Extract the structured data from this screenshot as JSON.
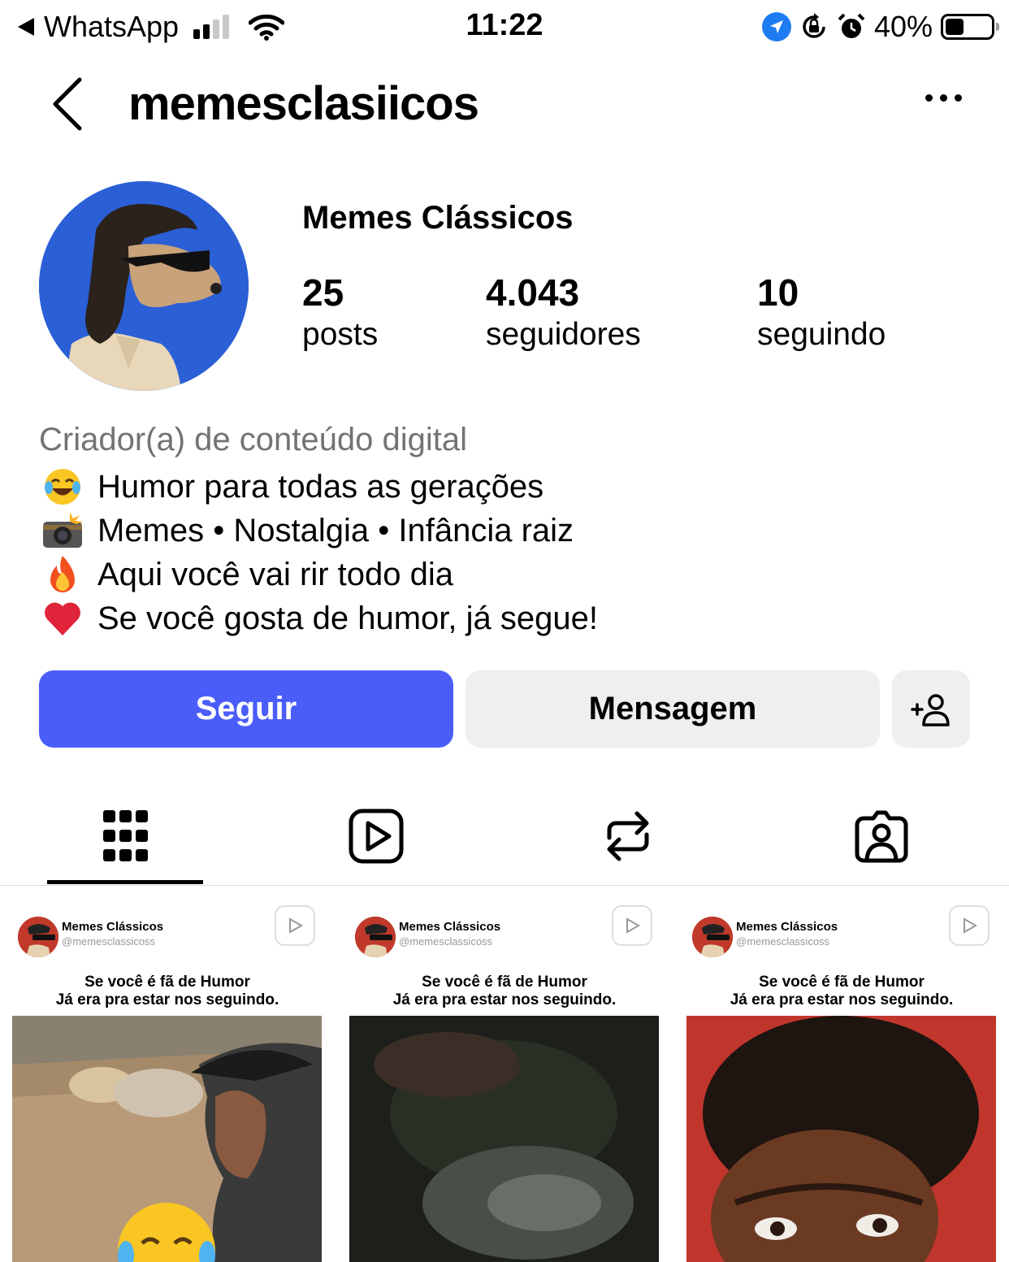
{
  "status_bar": {
    "back_app": "WhatsApp",
    "time": "11:22",
    "battery": "40%",
    "battery_level": 0.4
  },
  "header": {
    "username": "memesclasiicos"
  },
  "profile": {
    "display_name": "Memes Clássicos",
    "stats": [
      {
        "value": "25",
        "label": "posts"
      },
      {
        "value": "4.043",
        "label": "seguidores"
      },
      {
        "value": "10",
        "label": "seguindo"
      }
    ],
    "category": "Criador(a) de conteúdo digital",
    "bio": [
      {
        "emoji": "laughing-tears",
        "text": "Humor para todas as gerações"
      },
      {
        "emoji": "camera-flash",
        "text": "Memes • Nostalgia • Infância raiz"
      },
      {
        "emoji": "fire",
        "text": "Aqui você vai rir todo dia"
      },
      {
        "emoji": "red-heart",
        "text": "Se você gosta de humor, já segue!"
      }
    ]
  },
  "actions": {
    "follow": "Seguir",
    "message": "Mensagem"
  },
  "colors": {
    "follow_button": "#4a5df9",
    "secondary_button": "#efefef",
    "avatar_bg": "#2b5fd6"
  },
  "tabs": [
    {
      "icon": "grid-icon",
      "active": true
    },
    {
      "icon": "reels-icon",
      "active": false
    },
    {
      "icon": "reposts-icon",
      "active": false
    },
    {
      "icon": "tagged-icon",
      "active": false
    }
  ],
  "posts": [
    {
      "name": "Memes Clássicos",
      "handle": "@memesclassicoss",
      "caption_line1": "Se você é fã de Humor",
      "caption_line2": "Já era pra estar nos seguindo."
    },
    {
      "name": "Memes Clássicos",
      "handle": "@memesclassicoss",
      "caption_line1": "Se você é fã de Humor",
      "caption_line2": "Já era pra estar nos seguindo."
    },
    {
      "name": "Memes Clássicos",
      "handle": "@memesclassicoss",
      "caption_line1": "Se você é fã de Humor",
      "caption_line2": "Já era pra estar nos seguindo."
    }
  ]
}
